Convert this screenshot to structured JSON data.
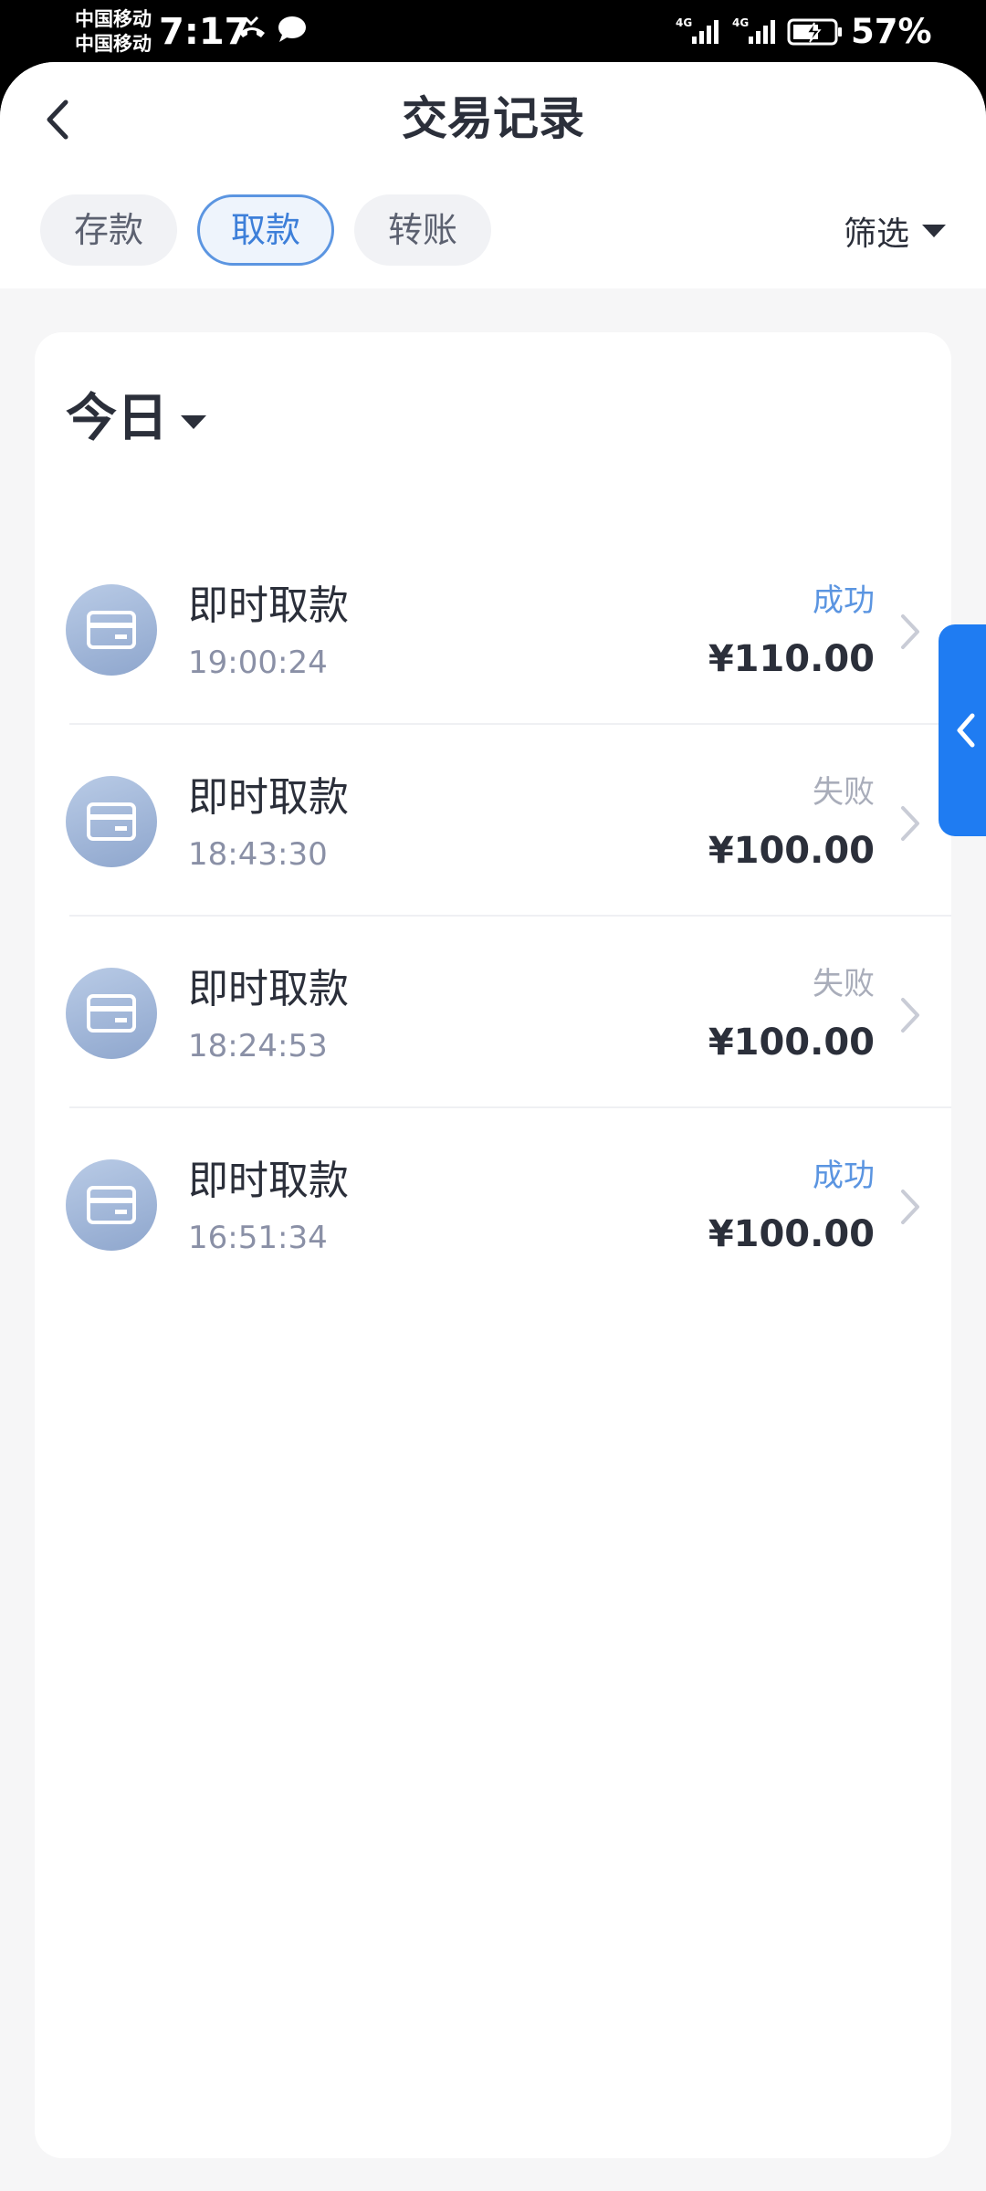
{
  "status_bar": {
    "carrier_1": "中国移动",
    "carrier_2": "中国移动",
    "time": "7:17",
    "network_1": "4G",
    "network_2": "4G",
    "battery": "57%"
  },
  "header": {
    "title": "交易记录",
    "filter_label": "筛选"
  },
  "tabs": [
    {
      "label": "存款",
      "active": false
    },
    {
      "label": "取款",
      "active": true
    },
    {
      "label": "转账",
      "active": false
    }
  ],
  "list": {
    "date_label": "今日",
    "items": [
      {
        "title": "即时取款",
        "time": "19:00:24",
        "status": "成功",
        "amount": "¥110.00"
      },
      {
        "title": "即时取款",
        "time": "18:43:30",
        "status": "失败",
        "amount": "¥100.00"
      },
      {
        "title": "即时取款",
        "time": "18:24:53",
        "status": "失败",
        "amount": "¥100.00"
      },
      {
        "title": "即时取款",
        "time": "16:51:34",
        "status": "成功",
        "amount": "¥100.00"
      }
    ]
  },
  "colors": {
    "accent": "#5b95e1",
    "side_tab": "#1f7cf2",
    "success": "#5b95e1",
    "failed": "#a9adba"
  },
  "icons": {
    "back": "chevron-left-icon",
    "item": "card-icon",
    "item_arrow": "chevron-right-icon",
    "side_tab": "chevron-left-icon"
  }
}
